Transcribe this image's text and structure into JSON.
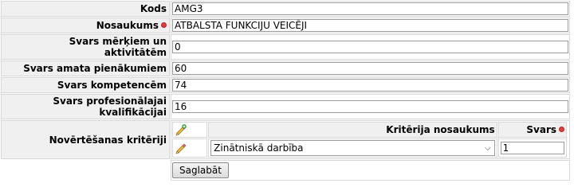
{
  "fields": {
    "kods": {
      "label": "Kods",
      "value": "AMG3"
    },
    "nosaukums": {
      "label": "Nosaukums",
      "value": "ATBALSTA FUNKCIJU VEICĒJI"
    },
    "svars_merkiem": {
      "label": "Svars mērķiem un aktivitātēm",
      "value": "0"
    },
    "svars_amata": {
      "label": "Svars amata pienākumiem",
      "value": "60"
    },
    "svars_kompetencem": {
      "label": "Svars kompetencēm",
      "value": "74"
    },
    "svars_kvalifikacijai": {
      "label": "Svars profesionālajai kvalifikācijai",
      "value": "16"
    }
  },
  "criteria": {
    "label": "Novērtēšanas kritēriji",
    "header_name": "Kritērija nosaukums",
    "header_weight": "Svars",
    "rows": [
      {
        "selected": "Zinātniskā darbība",
        "weight": "1"
      }
    ]
  },
  "actions": {
    "save_label": "Saglabāt"
  },
  "icons": {
    "required": "required-dot-icon",
    "edit": "pencil-icon"
  },
  "colors": {
    "label_bg": "#f0f0f0",
    "required": "#e23c3c"
  }
}
